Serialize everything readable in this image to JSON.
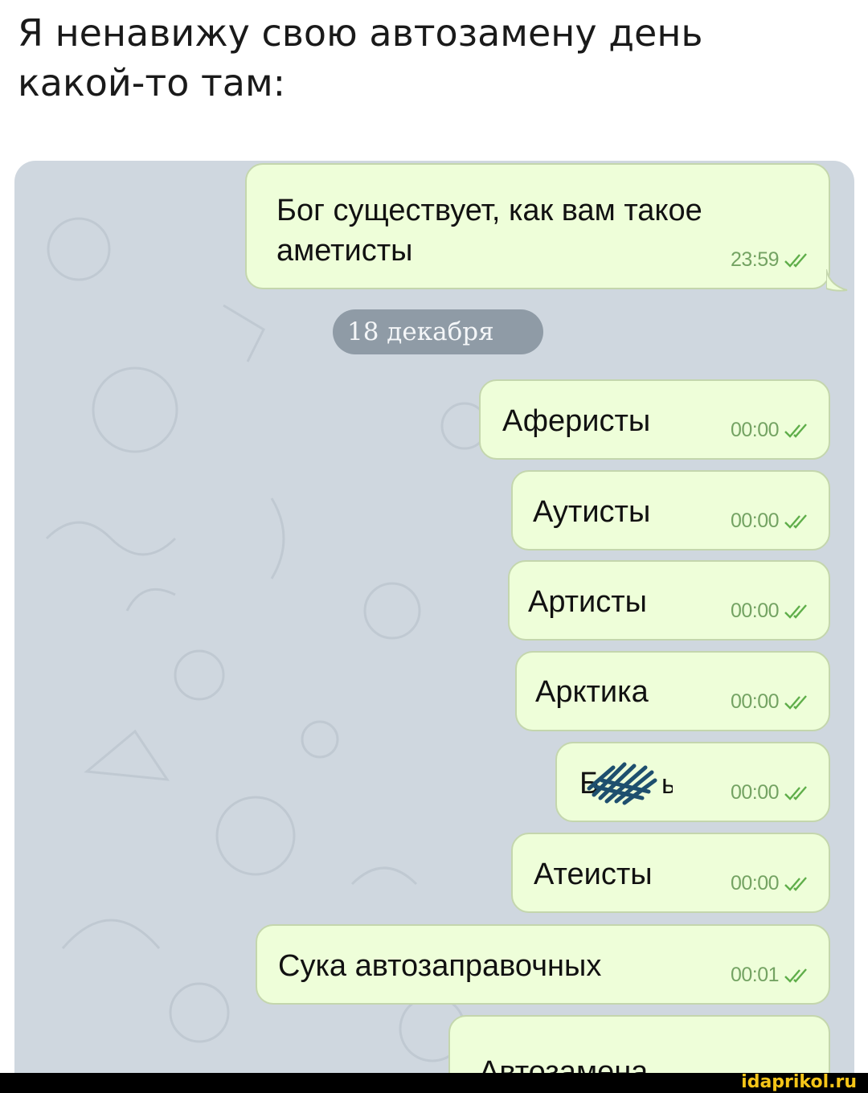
{
  "caption": {
    "line1": "Я ненавижу свою автозамену день",
    "line2": "какой-то там:"
  },
  "chat": {
    "background_color": "#cfd7df",
    "bubble_color": "#eefed9",
    "time_color": "#74a363",
    "date_divider": "18 декабря",
    "messages": [
      {
        "lines": [
          "Бог существует, как вам такое",
          "аметисты"
        ],
        "time": "23:59",
        "status": "read-double-check-icon"
      },
      {
        "text": "Аферисты",
        "time": "00:00",
        "status": "read-double-check-icon"
      },
      {
        "text": "Аутисты",
        "time": "00:00",
        "status": "read-double-check-icon"
      },
      {
        "text": "Артисты",
        "time": "00:00",
        "status": "read-double-check-icon"
      },
      {
        "text": "Арктика",
        "time": "00:00",
        "status": "read-double-check-icon"
      },
      {
        "text": "",
        "time": "00:00",
        "status": "read-double-check-icon",
        "censored": true
      },
      {
        "text": "Атеисты",
        "time": "00:00",
        "status": "read-double-check-icon"
      },
      {
        "text": "Сука автозаправочных",
        "time": "00:01",
        "status": "read-double-check-icon"
      },
      {
        "text": "Автозамена",
        "time": "",
        "status": ""
      }
    ]
  },
  "watermark": "idaprikol.ru"
}
